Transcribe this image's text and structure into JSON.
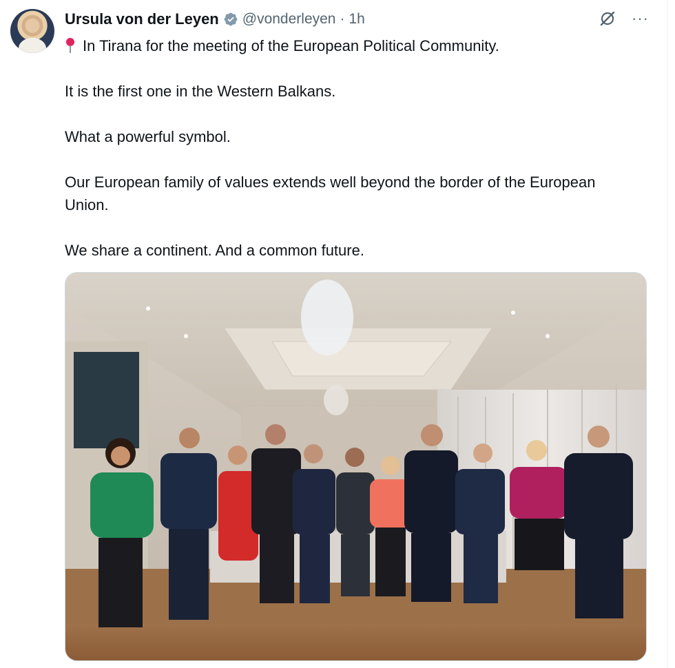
{
  "author": {
    "display_name": "Ursula von der Leyen",
    "handle": "@vonderleyen",
    "separator": "·",
    "time": "1h",
    "verified": true
  },
  "tweet": {
    "lines": [
      "In Tirana for the meeting of the European Political Community.",
      "It is the first one in the Western Balkans.",
      "What a powerful symbol.",
      "Our European family of values extends well beyond the border of the European Union.",
      "We share a continent. And a common future."
    ],
    "leading_emoji": "round-pushpin-icon"
  },
  "icons": {
    "grok": "grok-icon",
    "more": "···",
    "verified": "verified-badge-icon"
  },
  "media": {
    "type": "photo",
    "people_count": 11
  },
  "colors": {
    "text": "#0f1419",
    "secondary": "#536471",
    "verified": "#829aab",
    "pin": "#e0245e"
  }
}
